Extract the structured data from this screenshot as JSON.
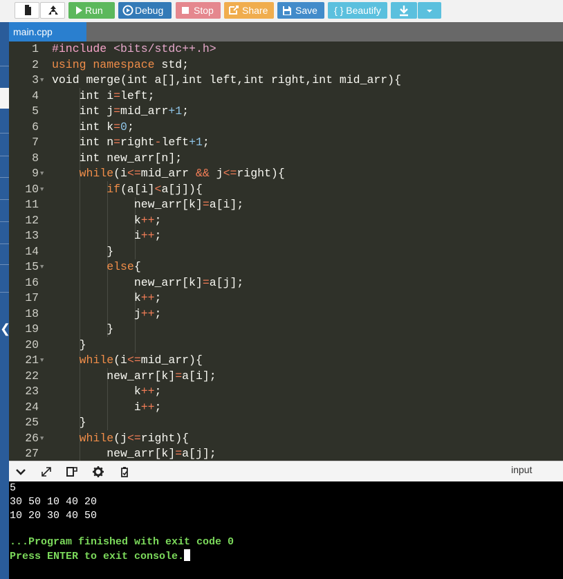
{
  "toolbar": {
    "run_label": "Run",
    "debug_label": "Debug",
    "stop_label": "Stop",
    "share_label": "Share",
    "save_label": "Save",
    "beautify_label": "{ } Beautify"
  },
  "tabs": [
    {
      "label": "main.cpp"
    }
  ],
  "editor": {
    "line_numbers": [
      "1",
      "2",
      "3",
      "4",
      "5",
      "6",
      "7",
      "8",
      "9",
      "10",
      "11",
      "12",
      "13",
      "14",
      "15",
      "16",
      "17",
      "18",
      "19",
      "20",
      "21",
      "22",
      "23",
      "24",
      "25",
      "26",
      "27"
    ]
  },
  "console_bar": {
    "input_label": "input"
  },
  "console": {
    "lines": [
      "5",
      "30 50 10 40 20",
      "10 20 30 40 50"
    ],
    "finished_message": "...Program finished with exit code 0",
    "exit_prompt": "Press ENTER to exit console."
  },
  "colors": {
    "run": "#5cb85c",
    "debug": "#337ab7",
    "stop": "#e5878e",
    "share": "#f0ad4e",
    "save": "#428bca",
    "beautify": "#5bc0de",
    "editor_bg": "#2f3129",
    "console_bg": "#000000",
    "console_green": "#7bd95b",
    "tab_active": "#2a7fcf"
  },
  "icons": [
    "new-file-icon",
    "upload-icon",
    "play-icon",
    "debug-icon",
    "stop-icon",
    "share-icon",
    "save-icon",
    "download-icon",
    "chevron-down-icon",
    "expand-icon",
    "split-icon",
    "gear-icon",
    "clipboard-icon"
  ]
}
